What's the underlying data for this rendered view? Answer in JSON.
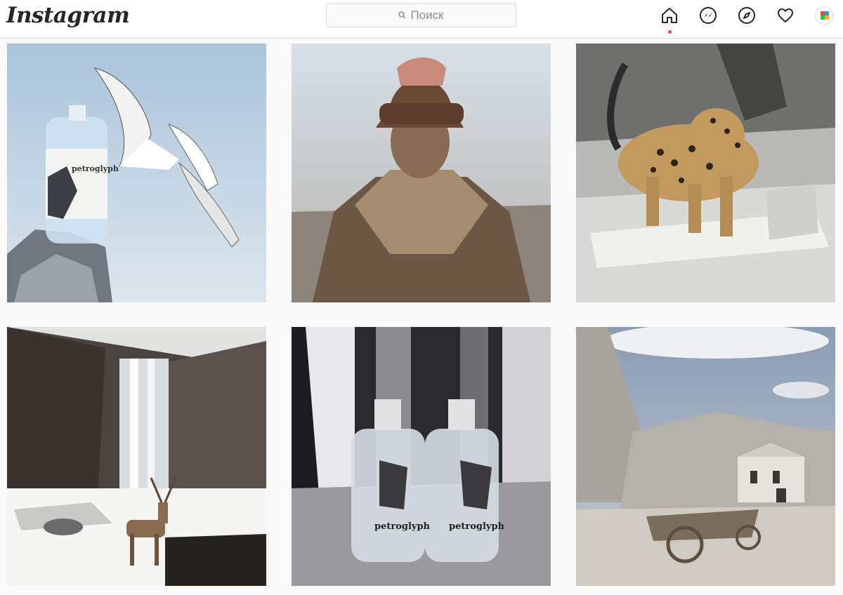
{
  "header": {
    "logo_text": "Instagram",
    "search_placeholder": "Поиск",
    "icons": [
      "home-icon",
      "messenger-icon",
      "explore-icon",
      "heart-icon",
      "avatar"
    ],
    "active_indicator_color": "#ed4956"
  },
  "feed": {
    "posts": [
      {
        "subject": "petroglyph bottle with seagulls",
        "label": "petroglyph"
      },
      {
        "subject": "man in fur hat"
      },
      {
        "subject": "jaguar on rocks"
      },
      {
        "subject": "waterfall with deer and wolf"
      },
      {
        "subject": "two petroglyph bottles",
        "label": "petroglyph"
      },
      {
        "subject": "stone chapel with cart"
      }
    ]
  }
}
